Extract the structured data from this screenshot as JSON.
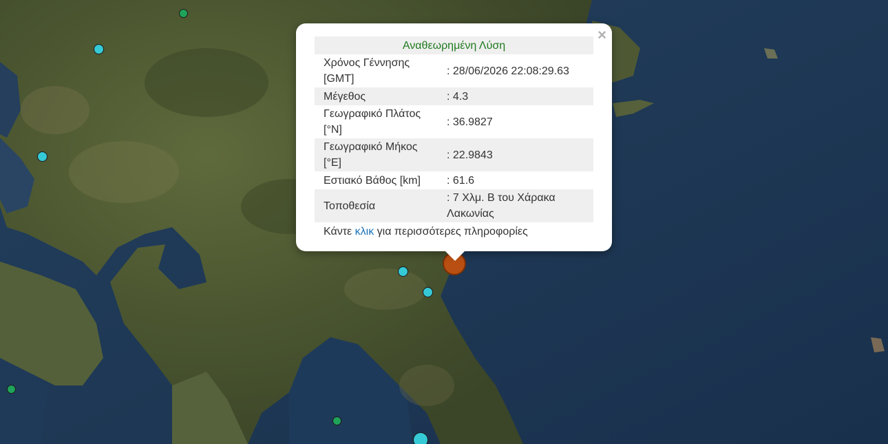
{
  "popup": {
    "title": "Αναθεωρημένη Λύση",
    "close_symbol": "×",
    "rows": [
      {
        "label": "Χρόνος Γέννησης [GMT]",
        "value": ": 28/06/2026 22:08:29.63"
      },
      {
        "label": "Μέγεθος",
        "value": ": 4.3"
      },
      {
        "label": "Γεωγραφικό Πλάτος [°N]",
        "value": ": 36.9827"
      },
      {
        "label": "Γεωγραφικό Μήκος [°E]",
        "value": ": 22.9843"
      },
      {
        "label": "Εστιακό Βάθος [km]",
        "value": ": 61.6"
      },
      {
        "label": "Τοποθεσία",
        "value": ": 7 Χλμ. Β του Χάρακα Λακωνίας"
      }
    ],
    "footer_prefix": "Κάντε",
    "footer_link": "κλικ",
    "footer_suffix": "για περισσότερες πληροφορίες"
  },
  "colors": {
    "title_green": "#1f7a1f",
    "link_blue": "#1a73b8",
    "marker_cyan": "#36c9d6",
    "marker_green": "#1fa35a",
    "marker_selected": "#b94f12"
  },
  "map": {
    "marker_types": [
      "cyan",
      "green",
      "selected"
    ]
  }
}
